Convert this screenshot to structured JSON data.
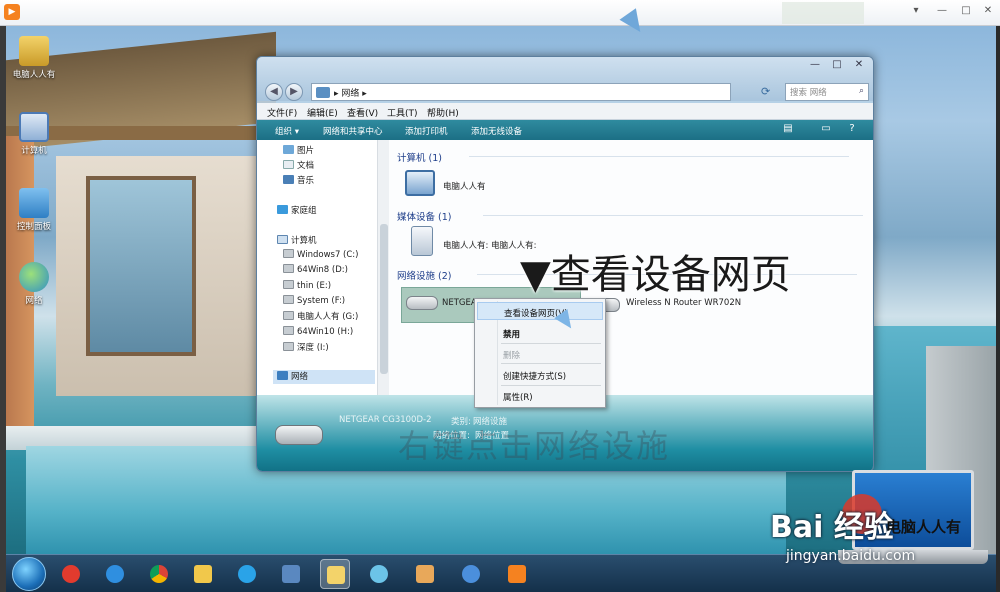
{
  "player": {
    "controls": [
      "▾",
      "—",
      "□",
      "✕"
    ]
  },
  "desktop": {
    "icons": [
      {
        "label": "电脑人人有",
        "icon": "user-folder-icon"
      },
      {
        "label": "计算机",
        "icon": "computer-icon"
      },
      {
        "label": "控制面板",
        "icon": "control-panel-icon"
      },
      {
        "label": "网络",
        "icon": "network-icon"
      }
    ]
  },
  "window": {
    "address": "▸ 网络 ▸",
    "search_placeholder": "搜索 网络",
    "controls": [
      "—",
      "□",
      "✕"
    ],
    "menu": [
      "文件(F)",
      "编辑(E)",
      "查看(V)",
      "工具(T)",
      "帮助(H)"
    ],
    "toolbar": [
      "组织 ▾",
      "网络和共享中心",
      "添加打印机",
      "添加无线设备"
    ]
  },
  "nav": {
    "items": [
      {
        "label": "图片",
        "icon": "pictures-icon"
      },
      {
        "label": "文档",
        "icon": "documents-icon"
      },
      {
        "label": "音乐",
        "icon": "music-icon"
      },
      {
        "label": "家庭组",
        "icon": "homegroup-icon"
      },
      {
        "label": "计算机",
        "icon": "computer-icon"
      },
      {
        "label": "Windows7 (C:)",
        "icon": "drive-icon"
      },
      {
        "label": "64Win8  (D:)",
        "icon": "drive-icon"
      },
      {
        "label": "thin (E:)",
        "icon": "drive-icon"
      },
      {
        "label": "System (F:)",
        "icon": "drive-icon"
      },
      {
        "label": "电脑人人有 (G:)",
        "icon": "drive-icon"
      },
      {
        "label": "64Win10 (H:)",
        "icon": "drive-icon"
      },
      {
        "label": "深度 (I:)",
        "icon": "drive-icon"
      },
      {
        "label": "网络",
        "icon": "network-icon"
      }
    ]
  },
  "content": {
    "groups": [
      {
        "title": "计算机 (1)",
        "items": [
          "电脑人人有"
        ]
      },
      {
        "title": "媒体设备 (1)",
        "items": [
          "电脑人人有: 电脑人人有:"
        ]
      },
      {
        "title": "网络设施 (2)",
        "items": [
          "NETGEAR CG3100D-2",
          "Wireless N Router WR702N"
        ]
      }
    ]
  },
  "details": {
    "name": "NETGEAR CG3100D-2",
    "category_label": "类别:",
    "category_value": "网络设施",
    "location_label": "网络位置:",
    "location_value": "网络位置"
  },
  "context_menu": {
    "items": [
      {
        "label": "查看设备网页(V)",
        "state": "highlighted"
      },
      {
        "label": "禁用",
        "state": "bold"
      },
      {
        "label": "删除",
        "state": "disabled"
      },
      {
        "label": "创建快捷方式(S)",
        "state": "normal"
      },
      {
        "label": "属性(R)",
        "state": "normal"
      }
    ]
  },
  "captions": {
    "big": "▼查看设备网页",
    "faint": "右键点击网络设施"
  },
  "taskbar": {
    "apps": [
      "360-browser-icon",
      "ie-icon",
      "chrome-icon",
      "folder-icon",
      "qq-browser-icon",
      "remote-desktop-icon",
      "explorer-icon",
      "pinwheel-icon",
      "paint-icon",
      "tablet-icon",
      "player-icon"
    ]
  },
  "watermark": {
    "brand": "Bai 经验",
    "url": "jingyan.baidu.com",
    "laptop_text": "电脑人人有"
  },
  "colors": {
    "toolbar": "#1c6f85",
    "selection": "#aac9bd",
    "menu_highlight": "#d6e8f8",
    "group_header": "#1e3e8a"
  }
}
